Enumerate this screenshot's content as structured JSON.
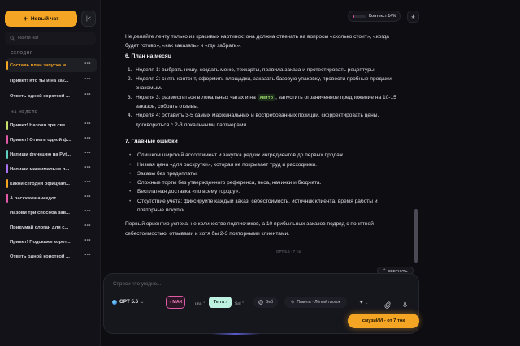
{
  "sidebar": {
    "new_chat_label": "Новый чат",
    "search_placeholder": "Найти чат",
    "section_today": "СЕГОДНЯ",
    "section_week": "НА НЕДЕЛЕ",
    "items": [
      {
        "label": "Составь план запуска м...",
        "color": "#f5a524",
        "active": true
      },
      {
        "label": "Привет! Кто ты и на как...",
        "color": "",
        "active": false
      },
      {
        "label": "Ответь одной короткой ...",
        "color": "",
        "active": false
      },
      {
        "label": "Привет! Назови три све...",
        "color": "#c8e06a",
        "active": false
      },
      {
        "label": "Привет! Ответь одной ф...",
        "color": "#e05aa8",
        "active": false
      },
      {
        "label": "Напиши функцию на Pyt...",
        "color": "#5fd0c0",
        "active": false
      },
      {
        "label": "Напиши максимально п...",
        "color": "#a872f0",
        "active": false
      },
      {
        "label": "Какой сегодня официал...",
        "color": "#f5a524",
        "active": false
      },
      {
        "label": "А расскажи анекдот",
        "color": "#e05aa8",
        "active": false
      },
      {
        "label": "Назови три способа зав...",
        "color": "",
        "active": false
      },
      {
        "label": "Придумай слоган для с...",
        "color": "",
        "active": false
      },
      {
        "label": "Привет! Подскажи корот...",
        "color": "",
        "active": false
      },
      {
        "label": "Ответь одной короткой ...",
        "color": "",
        "active": false
      }
    ],
    "more_icon": "•••"
  },
  "topbar": {
    "context_label": "Контекст 14%",
    "context_percent": 14
  },
  "message": {
    "intro": "Не делайте ленту только из красивых картинок: она должна отвечать на вопросы «сколько стоит», «когда будет готово», «как заказать» и «где забрать».",
    "section6_title": "6. План на месяц",
    "plan": [
      {
        "n": "1.",
        "text": "Неделя 1: выбрать нишу, создать меню, техкарты, правила заказа и протестировать рецептуры."
      },
      {
        "n": "2.",
        "text": "Неделя 2: снять контент, оформить площадки, заказать базовую упаковку, провести пробные продажи знакомым."
      },
      {
        "n": "3.",
        "text_before": "Неделя 3: разместиться в локальных чатах и на ",
        "badge": "Авито",
        "text_after": ", запустить ограниченное предложение на 10-15 заказов, собрать отзывы."
      },
      {
        "n": "4.",
        "text": "Неделя 4: оставить 3-5 самых маржинальных и востребованных позиций, скорректировать цены, договориться с 2-3 локальными партнерами."
      }
    ],
    "section7_title": "7. Главные ошибки",
    "mistakes": [
      "Слишком широкий ассортимент и закупка редких ингредиентов до первых продаж.",
      "Низкая цена «для раскрутки», которая не покрывает труд и расходники.",
      "Заказы без предоплаты.",
      "Сложные торты без утвержденного референса, веса, начинки и бюджета.",
      "Бесплатная доставка «по всему городу».",
      "Отсутствие учета: фиксируйте каждый заказ, себестоимость, источник клиента, время работы и повторные покупки."
    ],
    "closing": "Первый ориентир успеха: не количество подписчиков, а 10 прибыльных заказов подряд с понятной себестоимостью, отзывами и хотя бы 2-3 повторными клиентами.",
    "meta": "GPT 5.5 · 7 ток"
  },
  "collapse_label": "СВЕРНУТЬ",
  "composer": {
    "placeholder": "Спроси что угодно...",
    "model": "GPT 5.6",
    "max_label": "MAX",
    "opt_luna": "Luna",
    "opt_luna_sup": "3",
    "opt_terra": "Terra",
    "opt_terra_sup": "7",
    "opt_sol": "Sol",
    "opt_sol_sup": "9",
    "web_label": "Веб",
    "memory_label": "Память · Лёгкий глоток"
  },
  "promo_label": "смузиИИ - от 7 ток"
}
